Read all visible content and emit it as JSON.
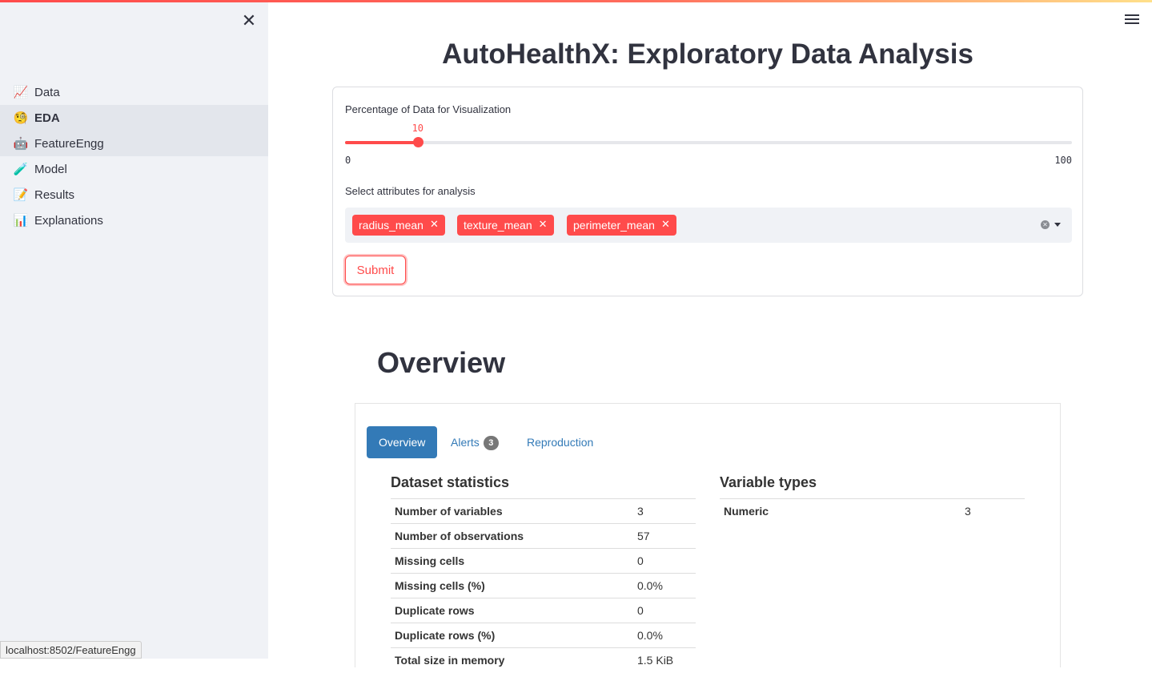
{
  "sidebar": {
    "close_icon": "close-icon",
    "items": [
      {
        "icon": "📈",
        "label": "Data"
      },
      {
        "icon": "🧐",
        "label": "EDA"
      },
      {
        "icon": "🤖",
        "label": "FeatureEngg"
      },
      {
        "icon": "🧪",
        "label": "Model"
      },
      {
        "icon": "📝",
        "label": "Results"
      },
      {
        "icon": "📊",
        "label": "Explanations"
      }
    ],
    "active_item": "EDA"
  },
  "status_bar": {
    "url": "localhost:8502/FeatureEngg"
  },
  "page": {
    "title": "AutoHealthX: Exploratory Data Analysis"
  },
  "form": {
    "slider": {
      "label": "Percentage of Data for Visualization",
      "value": 10,
      "min": 0,
      "max": 100,
      "value_text": "10",
      "min_text": "0",
      "max_text": "100"
    },
    "multiselect": {
      "label": "Select attributes for analysis",
      "selected": [
        "radius_mean",
        "texture_mean",
        "perimeter_mean"
      ]
    },
    "submit_label": "Submit"
  },
  "report": {
    "heading": "Overview",
    "tabs": {
      "overview": "Overview",
      "alerts": "Alerts",
      "alerts_count": "3",
      "reproduction": "Reproduction"
    },
    "dataset_statistics": {
      "title": "Dataset statistics",
      "rows": [
        {
          "key": "Number of variables",
          "value": "3"
        },
        {
          "key": "Number of observations",
          "value": "57"
        },
        {
          "key": "Missing cells",
          "value": "0"
        },
        {
          "key": "Missing cells (%)",
          "value": "0.0%"
        },
        {
          "key": "Duplicate rows",
          "value": "0"
        },
        {
          "key": "Duplicate rows (%)",
          "value": "0.0%"
        },
        {
          "key": "Total size in memory",
          "value": "1.5 KiB"
        }
      ]
    },
    "variable_types": {
      "title": "Variable types",
      "rows": [
        {
          "key": "Numeric",
          "value": "3"
        }
      ]
    }
  },
  "colors": {
    "accent": "#ff4b4b",
    "report_blue": "#337ab7",
    "sidebar_bg": "#f0f2f6"
  }
}
